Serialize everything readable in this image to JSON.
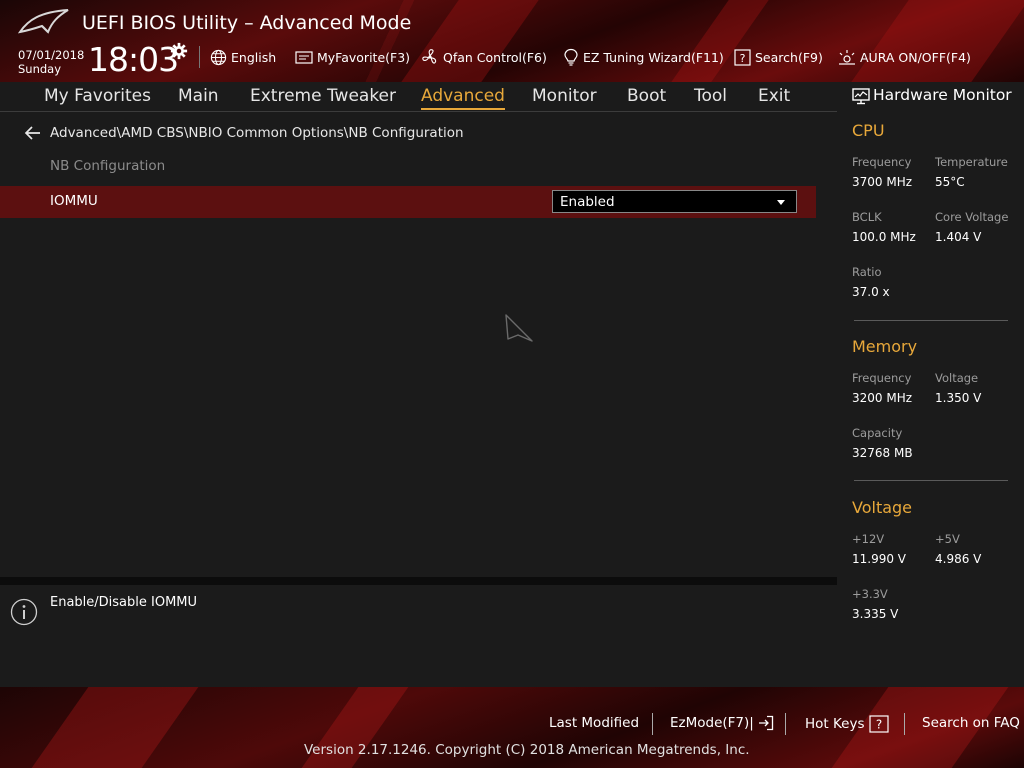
{
  "header": {
    "title": "UEFI BIOS Utility – Advanced Mode",
    "date": "07/01/2018",
    "day": "Sunday",
    "time": "18:03",
    "buttons": {
      "language": "English",
      "myfavorite": "MyFavorite(F3)",
      "qfan": "Qfan Control(F6)",
      "ez_tuning": "EZ Tuning Wizard(F11)",
      "search": "Search(F9)",
      "aura": "AURA ON/OFF(F4)"
    }
  },
  "nav": {
    "tabs": [
      "My Favorites",
      "Main",
      "Extreme Tweaker",
      "Advanced",
      "Monitor",
      "Boot",
      "Tool",
      "Exit"
    ],
    "active": "Advanced"
  },
  "main": {
    "breadcrumb": "Advanced\\AMD CBS\\NBIO Common Options\\NB Configuration",
    "section_label": "NB Configuration",
    "setting": {
      "name": "IOMMU",
      "value": "Enabled"
    }
  },
  "help": {
    "text": "Enable/Disable IOMMU"
  },
  "hardware_monitor": {
    "title": "Hardware Monitor",
    "cpu": {
      "heading": "CPU",
      "frequency_label": "Frequency",
      "frequency": "3700 MHz",
      "temperature_label": "Temperature",
      "temperature": "55°C",
      "bclk_label": "BCLK",
      "bclk": "100.0 MHz",
      "core_voltage_label": "Core Voltage",
      "core_voltage": "1.404 V",
      "ratio_label": "Ratio",
      "ratio": "37.0 x"
    },
    "memory": {
      "heading": "Memory",
      "frequency_label": "Frequency",
      "frequency": "3200 MHz",
      "voltage_label": "Voltage",
      "voltage": "1.350 V",
      "capacity_label": "Capacity",
      "capacity": "32768 MB"
    },
    "voltage": {
      "heading": "Voltage",
      "v12_label": "+12V",
      "v12": "11.990 V",
      "v5_label": "+5V",
      "v5": "4.986 V",
      "v33_label": "+3.3V",
      "v33": "3.335 V"
    }
  },
  "footer": {
    "last_modified": "Last Modified",
    "ezmode": "EzMode(F7)|",
    "hot_keys": "Hot Keys",
    "search_faq": "Search on FAQ",
    "copyright": "Version 2.17.1246. Copyright (C) 2018 American Megatrends, Inc."
  },
  "colors": {
    "accent": "#e8a83a",
    "selected_row": "#5c1010",
    "background": "#1b1b1b"
  },
  "icons": [
    "rog-logo-icon",
    "gear-icon",
    "globe-icon",
    "favorite-icon",
    "fan-icon",
    "bulb-icon",
    "help-box-icon",
    "aura-icon",
    "back-arrow-icon",
    "info-icon",
    "monitor-icon",
    "exit-icon",
    "question-icon",
    "mouse-cursor-icon"
  ]
}
